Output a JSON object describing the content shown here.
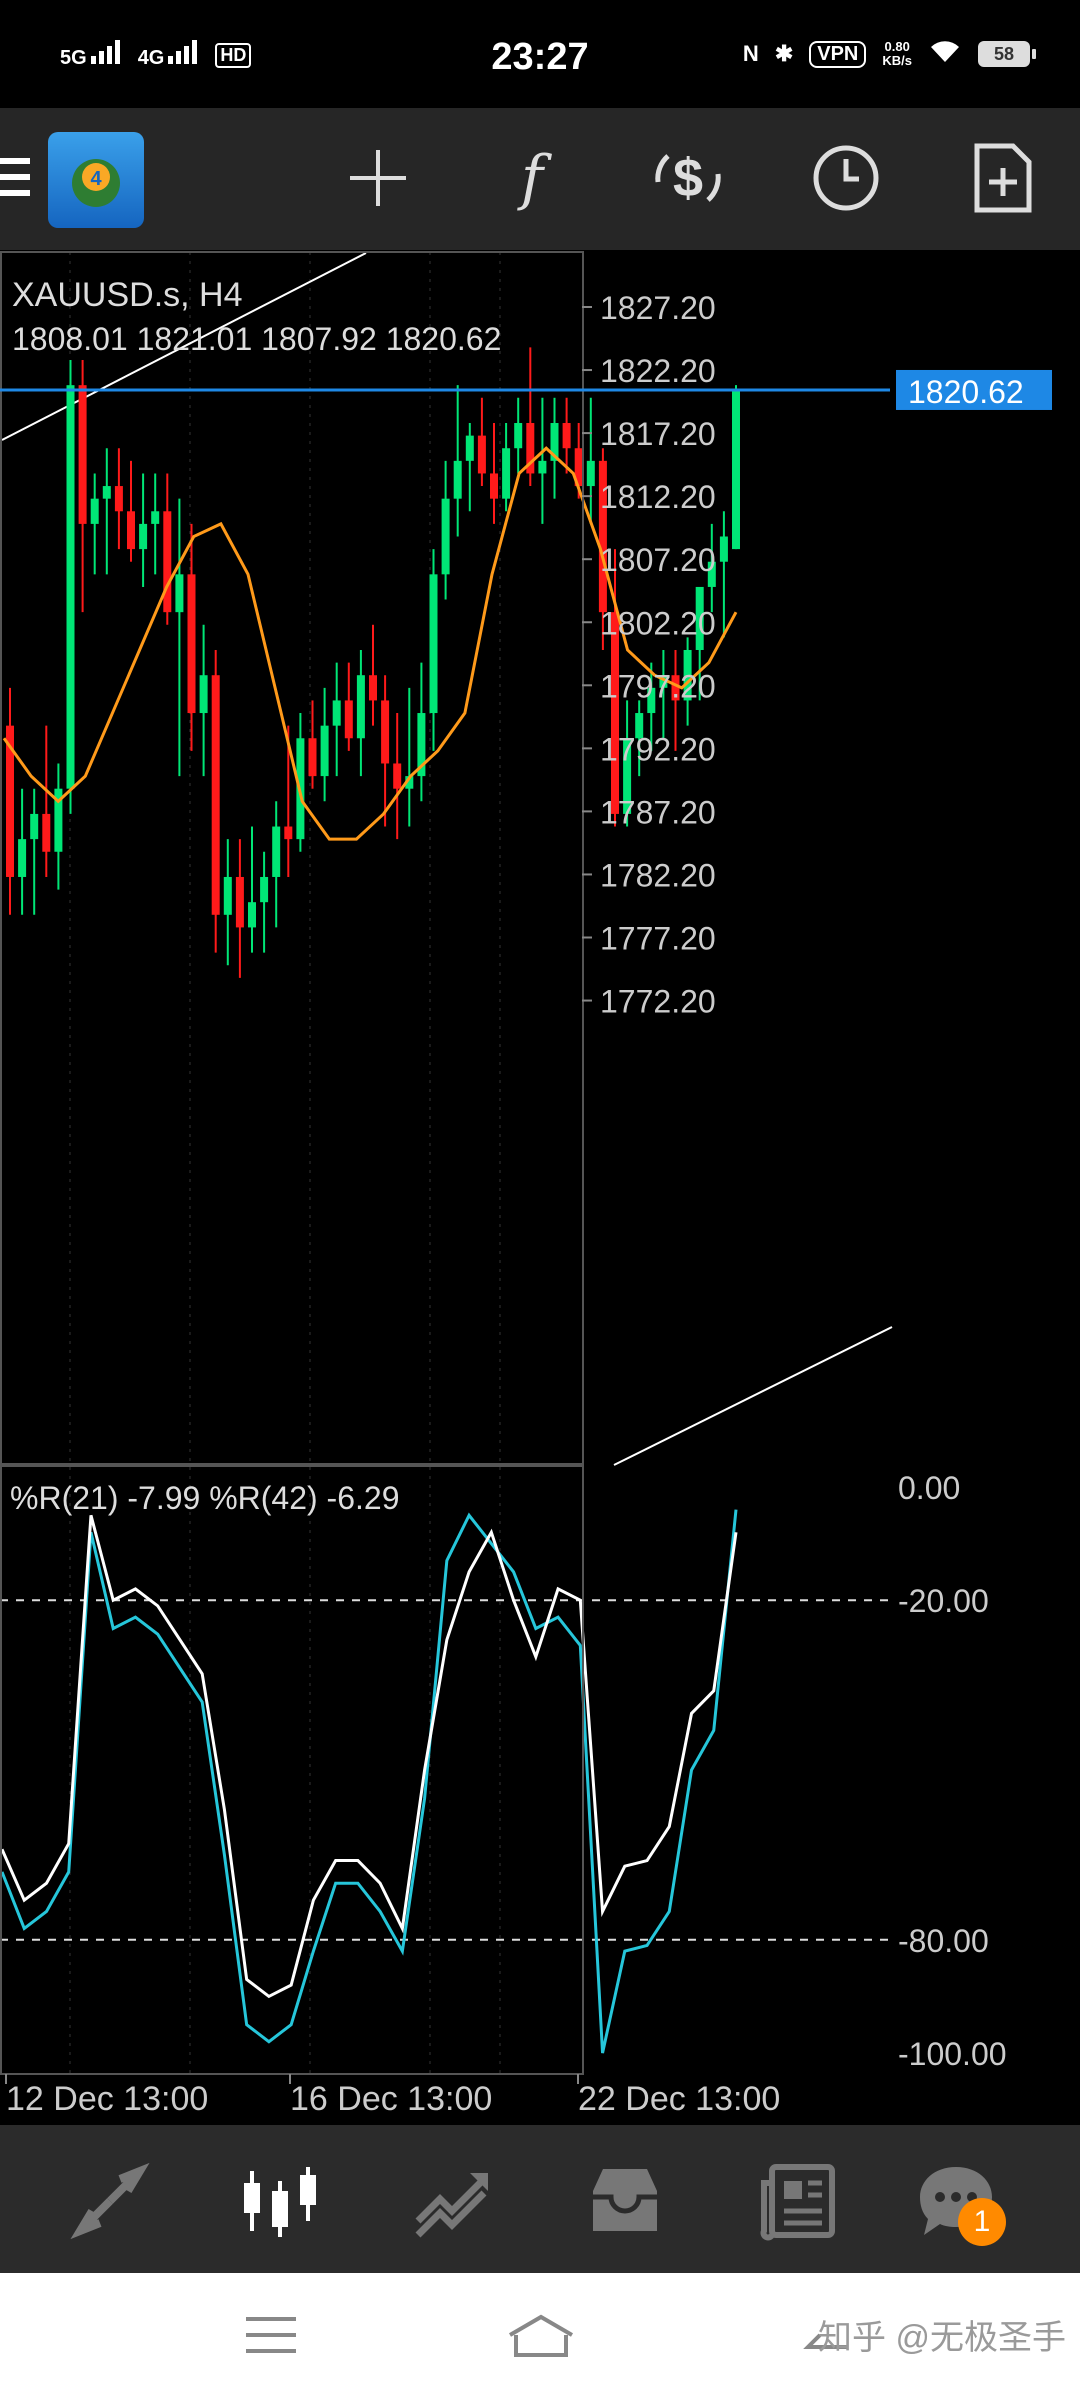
{
  "status_bar": {
    "time": "23:27",
    "network1": "5G",
    "network2": "4G",
    "hd": "HD",
    "vpn": "VPN",
    "speed_value": "0.80",
    "speed_unit": "KB/s",
    "battery": "58"
  },
  "toolbar": {
    "icons": [
      "menu-icon",
      "app-logo-icon",
      "crosshair-icon",
      "indicator-f-icon",
      "symbol-dollar-icon",
      "clock-icon",
      "new-order-icon"
    ],
    "indicator_glyph": "f",
    "dollar_glyph": "$"
  },
  "chart": {
    "symbol_label": "XAUUSD.s, H4",
    "ohlc_label": "1808.01 1821.01 1807.92 1820.62",
    "current_price": "1820.62",
    "price_ticks": [
      "1827.20",
      "1822.20",
      "1817.20",
      "1812.20",
      "1807.20",
      "1802.20",
      "1797.20",
      "1792.20",
      "1787.20",
      "1782.20",
      "1777.20",
      "1772.20"
    ],
    "oscillator_label": "%R(21) -7.99 %R(42) -6.29",
    "oscillator_ticks": [
      "0.00",
      "-20.00",
      "-80.00",
      "-100.00"
    ],
    "time_labels": [
      "12 Dec 13:00",
      "16 Dec 13:00",
      "22 Dec 13:00"
    ],
    "colors": {
      "bull": "#00e676",
      "bear": "#ff1a1a",
      "ma": "#ff9a1a",
      "wpr21": "#ffffff",
      "wpr42": "#26c6da",
      "price_line": "#1e88e5",
      "price_tag": "#1e88e5"
    }
  },
  "chart_data": {
    "type": "candlestick",
    "symbol": "XAUUSD.s",
    "timeframe": "H4",
    "ylim": [
      1769,
      1830
    ],
    "candles": [
      [
        1794,
        1797,
        1779,
        1782
      ],
      [
        1782,
        1789,
        1779,
        1785
      ],
      [
        1785,
        1789,
        1779,
        1787
      ],
      [
        1787,
        1794,
        1782,
        1784
      ],
      [
        1784,
        1791,
        1781,
        1789
      ],
      [
        1789,
        1823,
        1787,
        1821
      ],
      [
        1821,
        1823,
        1803,
        1810
      ],
      [
        1810,
        1814,
        1806,
        1812
      ],
      [
        1812,
        1816,
        1806,
        1813
      ],
      [
        1813,
        1816,
        1808,
        1811
      ],
      [
        1811,
        1815,
        1807,
        1808
      ],
      [
        1808,
        1814,
        1805,
        1810
      ],
      [
        1810,
        1814,
        1806,
        1811
      ],
      [
        1811,
        1814,
        1802,
        1803
      ],
      [
        1803,
        1812,
        1790,
        1806
      ],
      [
        1806,
        1810,
        1792,
        1795
      ],
      [
        1795,
        1802,
        1790,
        1798
      ],
      [
        1798,
        1800,
        1776,
        1779
      ],
      [
        1779,
        1785,
        1775,
        1782
      ],
      [
        1782,
        1785,
        1774,
        1778
      ],
      [
        1778,
        1786,
        1776,
        1780
      ],
      [
        1780,
        1784,
        1776,
        1782
      ],
      [
        1782,
        1788,
        1778,
        1786
      ],
      [
        1786,
        1794,
        1782,
        1785
      ],
      [
        1785,
        1795,
        1784,
        1793
      ],
      [
        1793,
        1796,
        1789,
        1790
      ],
      [
        1790,
        1797,
        1788,
        1794
      ],
      [
        1794,
        1799,
        1790,
        1796
      ],
      [
        1796,
        1799,
        1792,
        1793
      ],
      [
        1793,
        1800,
        1790,
        1798
      ],
      [
        1798,
        1802,
        1794,
        1796
      ],
      [
        1796,
        1798,
        1786,
        1791
      ],
      [
        1791,
        1795,
        1785,
        1789
      ],
      [
        1789,
        1797,
        1786,
        1790
      ],
      [
        1790,
        1799,
        1788,
        1795
      ],
      [
        1795,
        1808,
        1792,
        1806
      ],
      [
        1806,
        1815,
        1804,
        1812
      ],
      [
        1812,
        1821,
        1809,
        1815
      ],
      [
        1815,
        1818,
        1811,
        1817
      ],
      [
        1817,
        1820,
        1813,
        1814
      ],
      [
        1814,
        1818,
        1810,
        1812
      ],
      [
        1812,
        1818,
        1811,
        1816
      ],
      [
        1816,
        1820,
        1814,
        1818
      ],
      [
        1818,
        1824,
        1813,
        1814
      ],
      [
        1814,
        1820,
        1810,
        1815
      ],
      [
        1815,
        1820,
        1812,
        1818
      ],
      [
        1818,
        1820,
        1814,
        1816
      ],
      [
        1816,
        1818,
        1812,
        1813
      ],
      [
        1813,
        1820,
        1810,
        1815
      ],
      [
        1815,
        1816,
        1800,
        1803
      ],
      [
        1803,
        1808,
        1786,
        1787
      ],
      [
        1787,
        1796,
        1786,
        1793
      ],
      [
        1793,
        1796,
        1790,
        1795
      ],
      [
        1795,
        1799,
        1792,
        1797
      ],
      [
        1797,
        1800,
        1793,
        1798
      ],
      [
        1798,
        1800,
        1792,
        1796
      ],
      [
        1796,
        1801,
        1794,
        1800
      ],
      [
        1800,
        1805,
        1796,
        1805
      ],
      [
        1805,
        1810,
        1803,
        1807
      ],
      [
        1807,
        1811,
        1801,
        1809
      ],
      [
        1808,
        1821,
        1808,
        1820.62
      ]
    ],
    "ma_series": [
      1793,
      1790,
      1788,
      1790,
      1795,
      1800,
      1805,
      1809,
      1810,
      1806,
      1797,
      1788,
      1785,
      1785,
      1787,
      1790,
      1792,
      1795,
      1806,
      1814,
      1816,
      1814,
      1808,
      1800,
      1798,
      1797,
      1799,
      1803
    ],
    "wpr21": [
      -64,
      -73,
      -70,
      -63,
      -5,
      -20,
      -18,
      -21,
      -27,
      -33,
      -57,
      -87,
      -90,
      -88,
      -73,
      -66,
      -66,
      -70,
      -78,
      -50,
      -27,
      -15,
      -8,
      -20,
      -30,
      -18,
      -20,
      -75,
      -67,
      -66,
      -60,
      -40,
      -36,
      -8
    ],
    "wpr42": [
      -68,
      -78,
      -75,
      -68,
      -8,
      -25,
      -23,
      -26,
      -32,
      -38,
      -65,
      -95,
      -98,
      -95,
      -82,
      -70,
      -70,
      -75,
      -82,
      -55,
      -13,
      -5,
      -10,
      -15,
      -25,
      -23,
      -28,
      -100,
      -82,
      -81,
      -75,
      -50,
      -43,
      -4
    ]
  }
}
